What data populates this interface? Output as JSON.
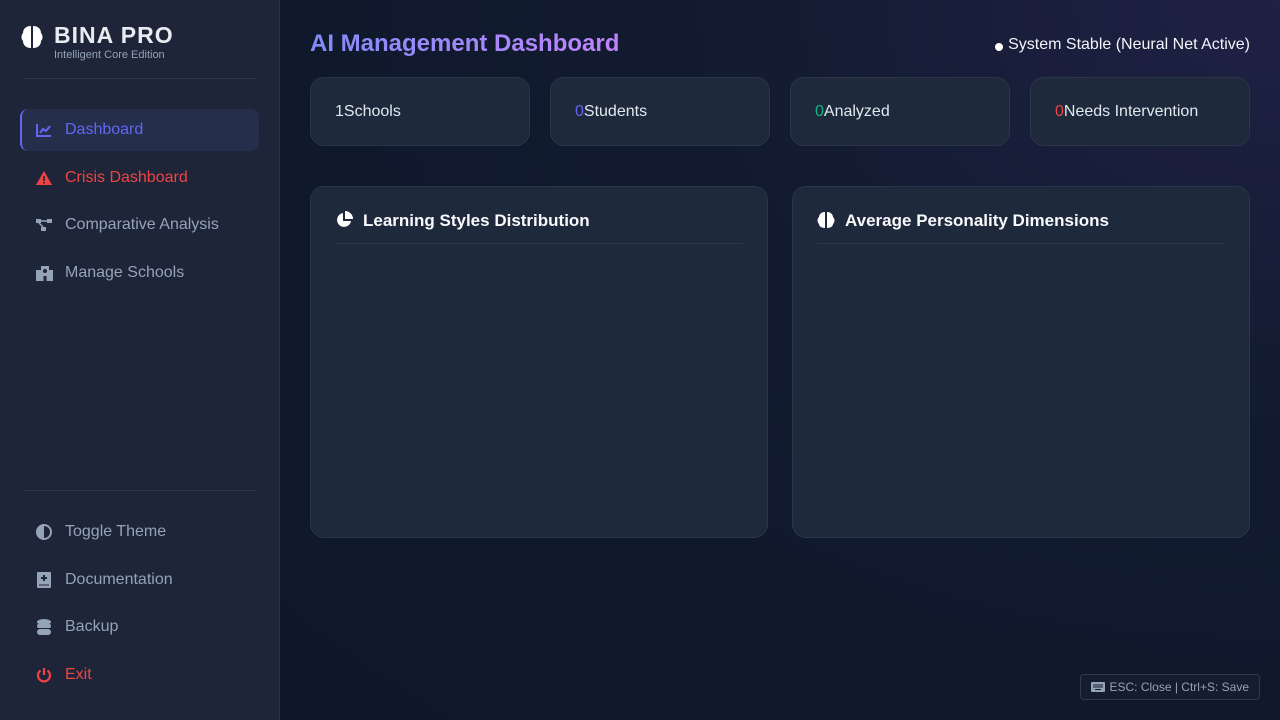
{
  "brand": {
    "title": "BINA PRO",
    "subtitle": "Intelligent Core Edition"
  },
  "nav": [
    {
      "label": "Dashboard",
      "icon": "chart-line-icon"
    },
    {
      "label": "Crisis Dashboard",
      "icon": "warning-icon"
    },
    {
      "label": "Comparative Analysis",
      "icon": "diagram-icon"
    },
    {
      "label": "Manage Schools",
      "icon": "school-icon"
    }
  ],
  "footer_nav": [
    {
      "label": "Toggle Theme",
      "icon": "contrast-icon"
    },
    {
      "label": "Documentation",
      "icon": "book-icon"
    },
    {
      "label": "Backup",
      "icon": "database-icon"
    },
    {
      "label": "Exit",
      "icon": "power-icon"
    }
  ],
  "header": {
    "title": "AI Management Dashboard",
    "status": "System Stable (Neural Net Active)"
  },
  "stats": [
    {
      "value": "1",
      "label": "Schools",
      "color": "#e2e8f0"
    },
    {
      "value": "0",
      "label": "Students",
      "color": "#6366f1"
    },
    {
      "value": "0",
      "label": "Analyzed",
      "color": "#10b981"
    },
    {
      "value": "0",
      "label": "Needs Intervention",
      "color": "#ef4444"
    }
  ],
  "panels": [
    {
      "title": "Learning Styles Distribution",
      "icon": "pie-chart-icon"
    },
    {
      "title": "Average Personality Dimensions",
      "icon": "brain-icon"
    }
  ],
  "shortcut": "ESC: Close | Ctrl+S: Save"
}
